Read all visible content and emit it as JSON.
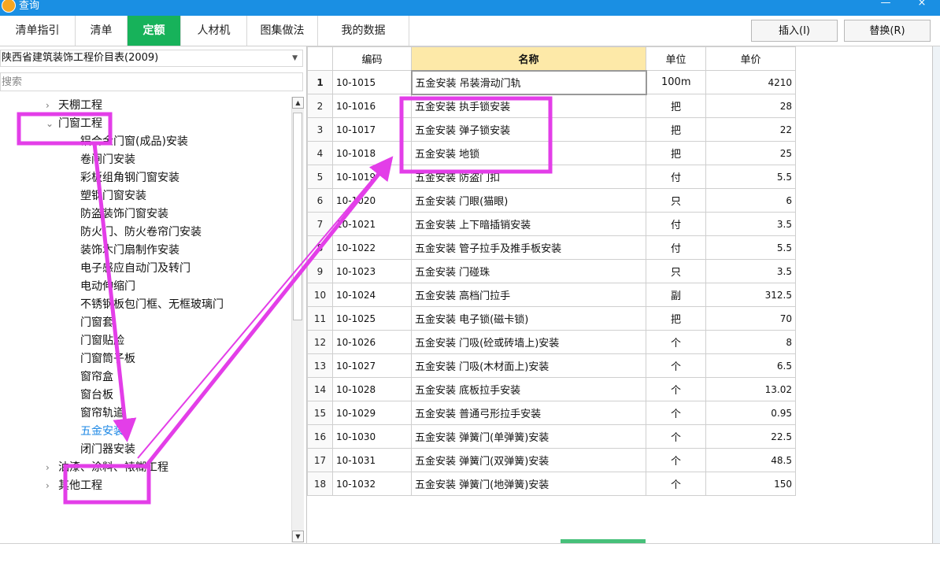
{
  "window": {
    "title": "查询",
    "minimize": "—",
    "close": "×"
  },
  "tabs": [
    {
      "label": "清单指引",
      "active": false
    },
    {
      "label": "清单",
      "active": false
    },
    {
      "label": "定额",
      "active": true
    },
    {
      "label": "人材机",
      "active": false
    },
    {
      "label": "图集做法",
      "active": false
    },
    {
      "label": "我的数据",
      "active": false
    }
  ],
  "actions": {
    "insert": "插入(I)",
    "replace": "替换(R)"
  },
  "left_panel": {
    "library": "陕西省建筑装饰工程价目表(2009)",
    "search_placeholder": "搜索",
    "tree": [
      {
        "label": "天棚工程",
        "expand": "collapsed",
        "level": 1
      },
      {
        "label": "门窗工程",
        "expand": "expanded",
        "level": 1
      },
      {
        "label": "铝合金门窗(成品)安装",
        "level": 2
      },
      {
        "label": "卷闸门安装",
        "level": 2
      },
      {
        "label": "彩板组角钢门窗安装",
        "level": 2
      },
      {
        "label": "塑钢门窗安装",
        "level": 2
      },
      {
        "label": "防盗装饰门窗安装",
        "level": 2
      },
      {
        "label": "防火门、防火卷帘门安装",
        "level": 2
      },
      {
        "label": "装饰木门扇制作安装",
        "level": 2
      },
      {
        "label": "电子感应自动门及转门",
        "level": 2
      },
      {
        "label": "电动伸缩门",
        "level": 2
      },
      {
        "label": "不锈钢板包门框、无框玻璃门",
        "level": 2
      },
      {
        "label": "门窗套",
        "level": 2
      },
      {
        "label": "门窗贴脸",
        "level": 2
      },
      {
        "label": "门窗筒子板",
        "level": 2
      },
      {
        "label": "窗帘盒",
        "level": 2
      },
      {
        "label": "窗台板",
        "level": 2
      },
      {
        "label": "窗帘轨道",
        "level": 2
      },
      {
        "label": "五金安装",
        "level": 2,
        "selected": true
      },
      {
        "label": "闭门器安装",
        "level": 2
      },
      {
        "label": "油漆、涂料、裱糊工程",
        "expand": "collapsed",
        "level": 1
      },
      {
        "label": "其他工程",
        "expand": "collapsed",
        "level": 1
      }
    ]
  },
  "grid": {
    "columns": [
      "",
      "编码",
      "名称",
      "单位",
      "单价"
    ],
    "rows": [
      [
        "1",
        "10-1015",
        "五金安装 吊装滑动门轨",
        "100m",
        "4210"
      ],
      [
        "2",
        "10-1016",
        "五金安装 执手锁安装",
        "把",
        "28"
      ],
      [
        "3",
        "10-1017",
        "五金安装 弹子锁安装",
        "把",
        "22"
      ],
      [
        "4",
        "10-1018",
        "五金安装 地锁",
        "把",
        "25"
      ],
      [
        "5",
        "10-1019",
        "五金安装 防盗门扣",
        "付",
        "5.5"
      ],
      [
        "6",
        "10-1020",
        "五金安装 门眼(猫眼)",
        "只",
        "6"
      ],
      [
        "7",
        "10-1021",
        "五金安装 上下暗插销安装",
        "付",
        "3.5"
      ],
      [
        "8",
        "10-1022",
        "五金安装 管子拉手及推手板安装",
        "付",
        "5.5"
      ],
      [
        "9",
        "10-1023",
        "五金安装 门碰珠",
        "只",
        "3.5"
      ],
      [
        "10",
        "10-1024",
        "五金安装 高档门拉手",
        "副",
        "312.5"
      ],
      [
        "11",
        "10-1025",
        "五金安装 电子锁(磁卡锁)",
        "把",
        "70"
      ],
      [
        "12",
        "10-1026",
        "五金安装 门吸(砼或砖墙上)安装",
        "个",
        "8"
      ],
      [
        "13",
        "10-1027",
        "五金安装 门吸(木材面上)安装",
        "个",
        "6.5"
      ],
      [
        "14",
        "10-1028",
        "五金安装 底板拉手安装",
        "个",
        "13.02"
      ],
      [
        "15",
        "10-1029",
        "五金安装 普通弓形拉手安装",
        "个",
        "0.95"
      ],
      [
        "16",
        "10-1030",
        "五金安装 弹簧门(单弹簧)安装",
        "个",
        "22.5"
      ],
      [
        "17",
        "10-1031",
        "五金安装 弹簧门(双弹簧)安装",
        "个",
        "48.5"
      ],
      [
        "18",
        "10-1032",
        "五金安装 弹簧门(地弹簧)安装",
        "个",
        "150"
      ]
    ]
  },
  "colors": {
    "titlebar": "#1a8fe3",
    "active_tab": "#17b25a",
    "name_header": "#fde9a8",
    "annotation": "#e33ee8",
    "selected_text": "#1e88e5"
  }
}
